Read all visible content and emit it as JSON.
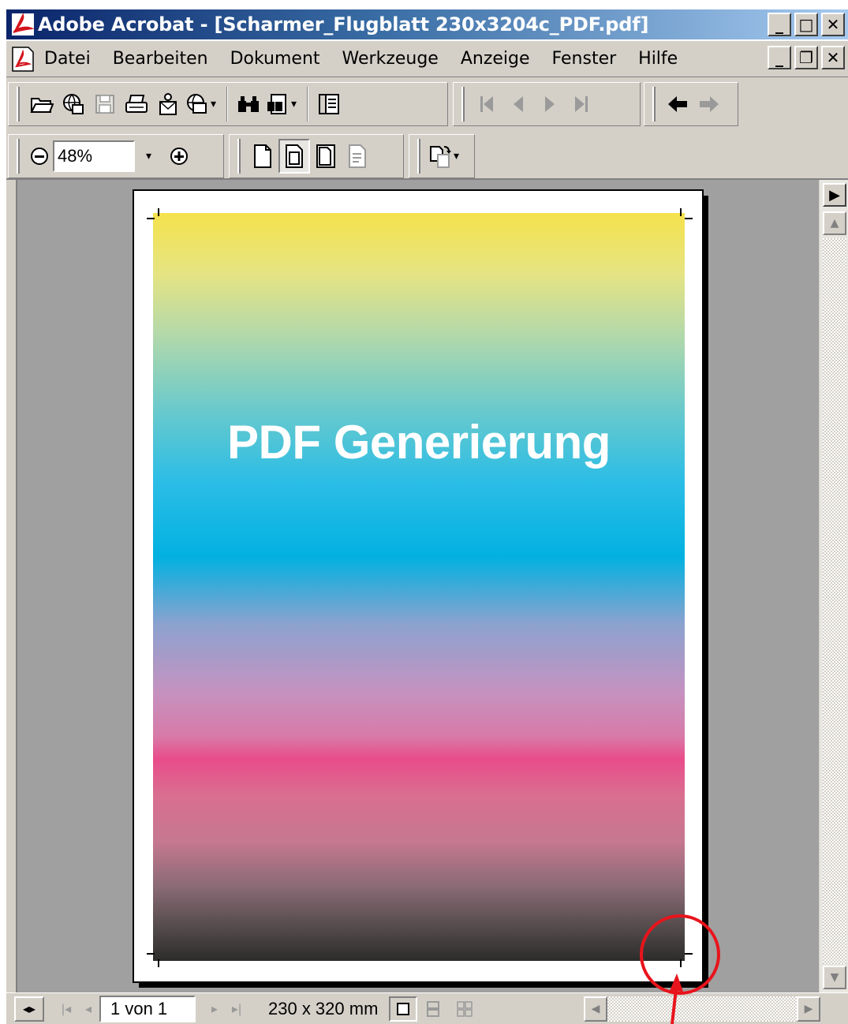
{
  "window": {
    "title": "Adobe Acrobat - [Scharmer_Flugblatt 230x3204c_PDF.pdf]",
    "controls": [
      "_",
      "□",
      "✕"
    ],
    "mdi_controls": [
      "_",
      "❐",
      "✕"
    ]
  },
  "menubar": {
    "items": [
      "Datei",
      "Bearbeiten",
      "Dokument",
      "Werkzeuge",
      "Anzeige",
      "Fenster",
      "Hilfe"
    ]
  },
  "toolbar": {
    "zoom_value": "48%"
  },
  "document": {
    "headline": "PDF Generierung"
  },
  "statusbar": {
    "page_indicator": "1 von 1",
    "page_size": "230 x 320 mm"
  },
  "colors": {
    "annotation": "#e8141c",
    "title_gradient_start": "#0a246a",
    "chrome": "#d4d0c8"
  },
  "icons": {
    "app": "acrobat-logo-icon",
    "toolbar": [
      "open-folder-icon",
      "web-open-icon",
      "save-icon",
      "print-icon",
      "email-icon",
      "search-web-icon",
      "find-binoculars-icon",
      "search-icon",
      "hand-pages-icon",
      "first-page-icon",
      "previous-page-icon",
      "next-page-icon",
      "last-page-icon",
      "back-icon",
      "forward-icon",
      "zoom-out-icon",
      "zoom-in-icon",
      "actual-size-icon",
      "fit-page-icon",
      "fit-width-icon",
      "reflow-icon",
      "rotate-icon"
    ]
  }
}
